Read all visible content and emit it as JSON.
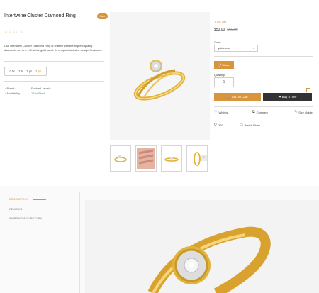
{
  "product": {
    "title": "Intertwine Cluster Diamond Ring",
    "badge": "Sale",
    "rating_stars": "☆☆☆☆☆",
    "description": "Our Intertwine Cluster Diamond Ring is crafted with the highest quality diamonds set in a 14K white gold band. Its unique intertwine design Featured...",
    "timer": {
      "days": "0 ts",
      "hours": "1 h",
      "mins": "7 pt",
      "secs": "3 ps"
    },
    "brand_label": "Brand :",
    "brand_value": "Evolved Jewels",
    "availability_label": "Availability :",
    "availability_value": "12 In Stock"
  },
  "purchase": {
    "discount": "17% off",
    "price": "$50.00",
    "old_price": "$60.00",
    "color_label": "Color",
    "color_value": "goldenrod",
    "share_label": "Share",
    "quantity_label": "Quantity",
    "quantity_value": "1",
    "add_to_cart": "Add to Cart",
    "buy_now": "Buy it now",
    "wishlist": "Wishlist",
    "compare": "Compare",
    "size_guide": "Size Guide",
    "view_360": "360",
    "watch_video": "Watch Video"
  },
  "tabs": [
    {
      "label": "DESCRIPTION"
    },
    {
      "label": "REVIEWS"
    },
    {
      "label": "SHIPPING AND RETURN"
    }
  ],
  "colors": {
    "accent": "#d8953d",
    "dark": "#333333",
    "gold": "#e2b23a"
  }
}
